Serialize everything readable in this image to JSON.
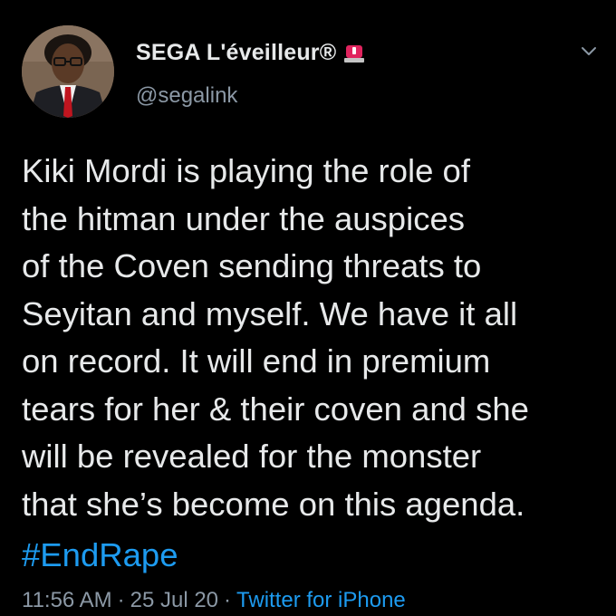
{
  "colors": {
    "background": "#000000",
    "text_primary": "#e7e9ea",
    "text_secondary": "#8b98a5",
    "accent": "#1d9bf0",
    "siren_red": "#e0245e"
  },
  "author": {
    "display_name": "SEGA L'éveilleur®",
    "handle": "@segalink",
    "badge_icon": "police-siren-icon"
  },
  "menu": {
    "icon": "chevron-down-icon"
  },
  "tweet": {
    "text": "Kiki Mordi is playing the role of\nthe hitman under the auspices\nof the Coven sending threats to\nSeyitan and myself. We have it all\non record. It will end in premium\ntears for her & their coven and she\nwill be revealed for the monster\nthat she’s become on this agenda.",
    "hashtag": "#EndRape"
  },
  "meta": {
    "time": "11:56 AM",
    "date": "25 Jul 20",
    "separator": "·",
    "source": "Twitter for iPhone"
  }
}
